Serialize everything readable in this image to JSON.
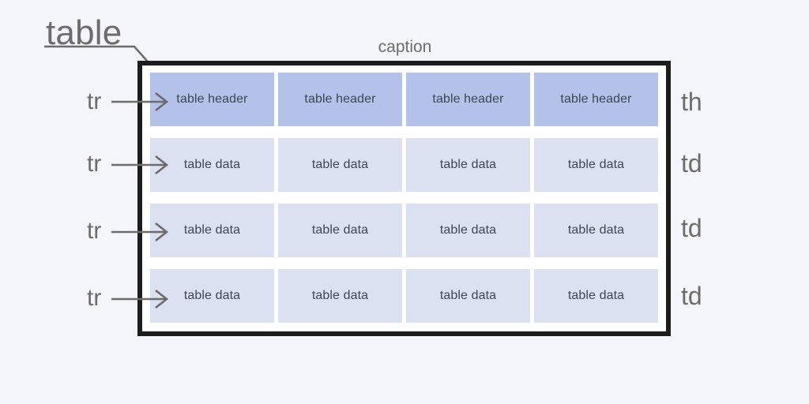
{
  "diagram": {
    "title_label": "table",
    "caption_label": "caption",
    "row_labels": [
      "tr",
      "tr",
      "tr",
      "tr"
    ],
    "side_labels": [
      "th",
      "td",
      "td",
      "td"
    ],
    "rows": [
      {
        "type": "th",
        "cells": [
          "table header",
          "table header",
          "table header",
          "table header"
        ]
      },
      {
        "type": "td",
        "cells": [
          "table data",
          "table data",
          "table data",
          "table data"
        ]
      },
      {
        "type": "td",
        "cells": [
          "table data",
          "table data",
          "table data",
          "table data"
        ]
      },
      {
        "type": "td",
        "cells": [
          "table data",
          "table data",
          "table data",
          "table data"
        ]
      }
    ],
    "colors": {
      "background": "#f4f5fa",
      "table_border": "#1c1c1c",
      "table_inner": "#ffffff",
      "header_cell": "#b4c1e8",
      "data_cell": "#dce1f2",
      "cell_text": "#3c4652",
      "label_text": "#6c6c6c",
      "arrow": "#6c6c6c"
    }
  }
}
